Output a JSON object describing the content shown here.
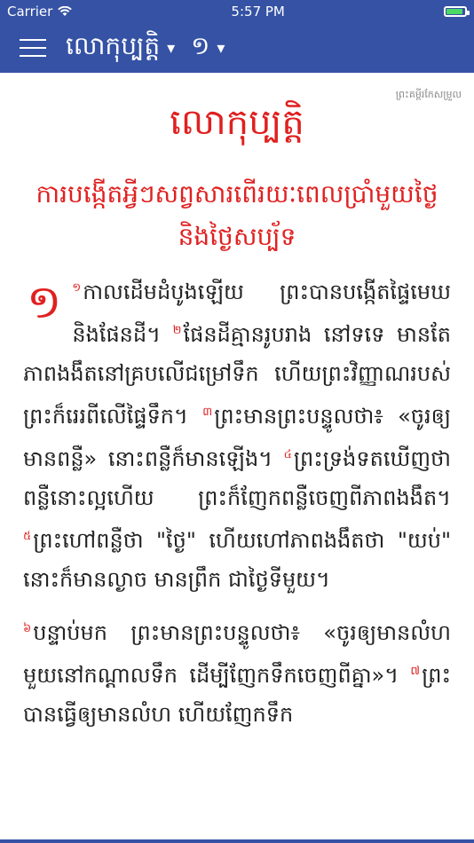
{
  "status": {
    "carrier": "Carrier",
    "time": "5:57 PM"
  },
  "appbar": {
    "book": "លោកុប្បត្តិ",
    "book_caret": "▾",
    "chapter": "១",
    "chapter_caret": "▾"
  },
  "version_label": "ព្រះគម្ពីរកែសម្រួល",
  "book_title": "លោកុប្បត្តិ",
  "section_heading": "ការបង្កើតអ្វីៗសព្វសារពើរយៈពេលប្រាំមួយថ្ងៃ និងថ្ងៃសប្ប័ទ",
  "chapter_number": "១",
  "verses": [
    {
      "n": "១",
      "text": "កាលដើមដំបូងឡើយ ព្រះបានបង្កើតផ្ទៃមេឃ និងផែនដី។ "
    },
    {
      "n": "២",
      "text": "ផែនដីគ្មានរូបរាង នៅទទេ មានតែភាពងងឹតនៅគ្របលើជម្រៅទឹក ហើយព្រះវិញ្ញាណរបស់ព្រះក៏រេរពីលើផ្ទៃទឹក។ "
    },
    {
      "n": "៣",
      "text": "ព្រះមានព្រះបន្ទូលថា៖ «ចូរឲ្យមានពន្លឺ» នោះពន្លឺក៏មានឡើង។ "
    },
    {
      "n": "៤",
      "text": "ព្រះទ្រង់ទតឃើញថា ពន្លឺនោះល្អហើយ ព្រះក៏ញែកពន្លឺចេញពីភាពងងឹត។ "
    },
    {
      "n": "៥",
      "text": "ព្រះហៅពន្លឺថា \"ថ្ងៃ\" ហើយហៅភាពងងឹតថា \"យប់\" នោះក៏មានល្ងាច មានព្រឹក ជាថ្ងៃទីមួយ។"
    }
  ],
  "verses2": [
    {
      "n": "៦",
      "text": "បន្ទាប់មក ព្រះមានព្រះបន្ទូលថា៖ «ចូរឲ្យមានលំហមួយនៅកណ្ដាលទឹក ដើម្បីញែកទឹកចេញពីគ្នា»។ "
    },
    {
      "n": "៧",
      "text": "ព្រះបានធ្វើឲ្យមានលំហ ហើយញែកទឹក"
    }
  ]
}
